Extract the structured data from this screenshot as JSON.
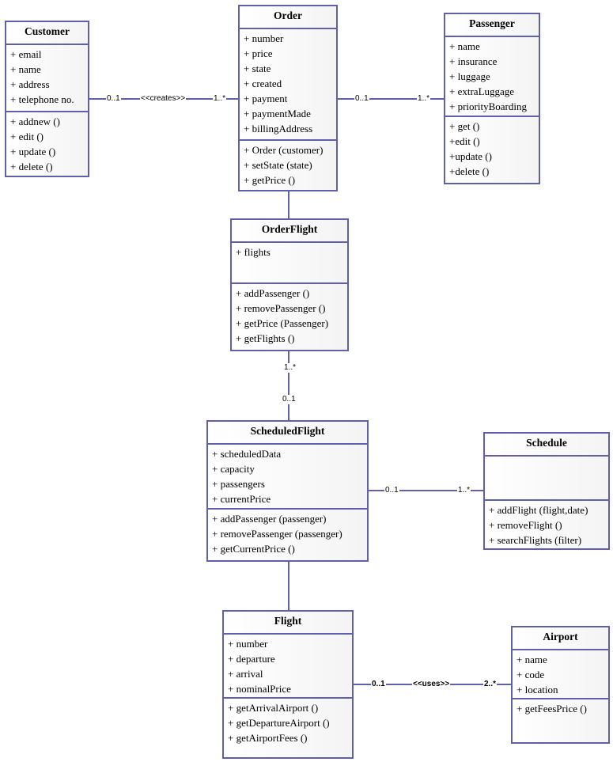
{
  "colors": {
    "border": "#6060aa",
    "line": "#6060aa"
  },
  "classes": [
    {
      "id": "customer",
      "name": "Customer",
      "attributes": [
        "+ email",
        "+ name",
        "+ address",
        "+ telephone no."
      ],
      "methods": [
        "+ addnew ()",
        "+ edit ()",
        "+ update ()",
        "+ delete ()"
      ]
    },
    {
      "id": "order",
      "name": "Order",
      "attributes": [
        "+ number",
        "+ price",
        "+ state",
        "+ created",
        "+ payment",
        "+ paymentMade",
        "+ billingAddress"
      ],
      "methods": [
        "+ Order (customer)",
        "+ setState (state)",
        "+ getPrice ()"
      ]
    },
    {
      "id": "passenger",
      "name": "Passenger",
      "attributes": [
        "+ name",
        "+ insurance",
        "+ luggage",
        "+ extraLuggage",
        "+ priorityBoarding"
      ],
      "methods": [
        "+ get ()",
        "+edit ()",
        "+update ()",
        "+delete ()"
      ]
    },
    {
      "id": "orderflight",
      "name": "OrderFlight",
      "attributes": [
        "+ flights"
      ],
      "methods": [
        "+ addPassenger ()",
        "+ removePassenger ()",
        "+ getPrice (Passenger)",
        "+ getFlights ()"
      ]
    },
    {
      "id": "scheduledflight",
      "name": "ScheduledFlight",
      "attributes": [
        "+ scheduledData",
        "+ capacity",
        "+ passengers",
        "+ currentPrice"
      ],
      "methods": [
        "+ addPassenger (passenger)",
        "+ removePassenger (passenger)",
        "+ getCurrentPrice ()"
      ]
    },
    {
      "id": "schedule",
      "name": "Schedule",
      "attributes": [],
      "methods": [
        "+ addFlight (flight,date)",
        "+ removeFlight ()",
        "+ searchFlights (filter)"
      ]
    },
    {
      "id": "flight",
      "name": "Flight",
      "attributes": [
        "+ number",
        "+ departure",
        "+ arrival",
        "+ nominalPrice"
      ],
      "methods": [
        "+ getArrivalAirport ()",
        "+ getDepartureAirport ()",
        "+ getAirportFees ()"
      ]
    },
    {
      "id": "airport",
      "name": "Airport",
      "attributes": [
        "+ name",
        "+ code",
        "+ location"
      ],
      "methods": [
        "+ getFeesPrice ()"
      ]
    }
  ],
  "associations": [
    {
      "from": "customer",
      "to": "order",
      "from_mult": "0..1",
      "to_mult": "1..*",
      "stereotype": "<<creates>>"
    },
    {
      "from": "order",
      "to": "passenger",
      "from_mult": "0..1",
      "to_mult": "1..*"
    },
    {
      "from": "order",
      "to": "orderflight"
    },
    {
      "from": "orderflight",
      "to": "scheduledflight",
      "from_mult": "1..*",
      "to_mult": "0..1"
    },
    {
      "from": "scheduledflight",
      "to": "schedule",
      "from_mult": "0..1",
      "to_mult": "1..*"
    },
    {
      "from": "scheduledflight",
      "to": "flight"
    },
    {
      "from": "flight",
      "to": "airport",
      "from_mult": "0..1",
      "to_mult": "2..*",
      "stereotype": "<<uses>>"
    }
  ]
}
